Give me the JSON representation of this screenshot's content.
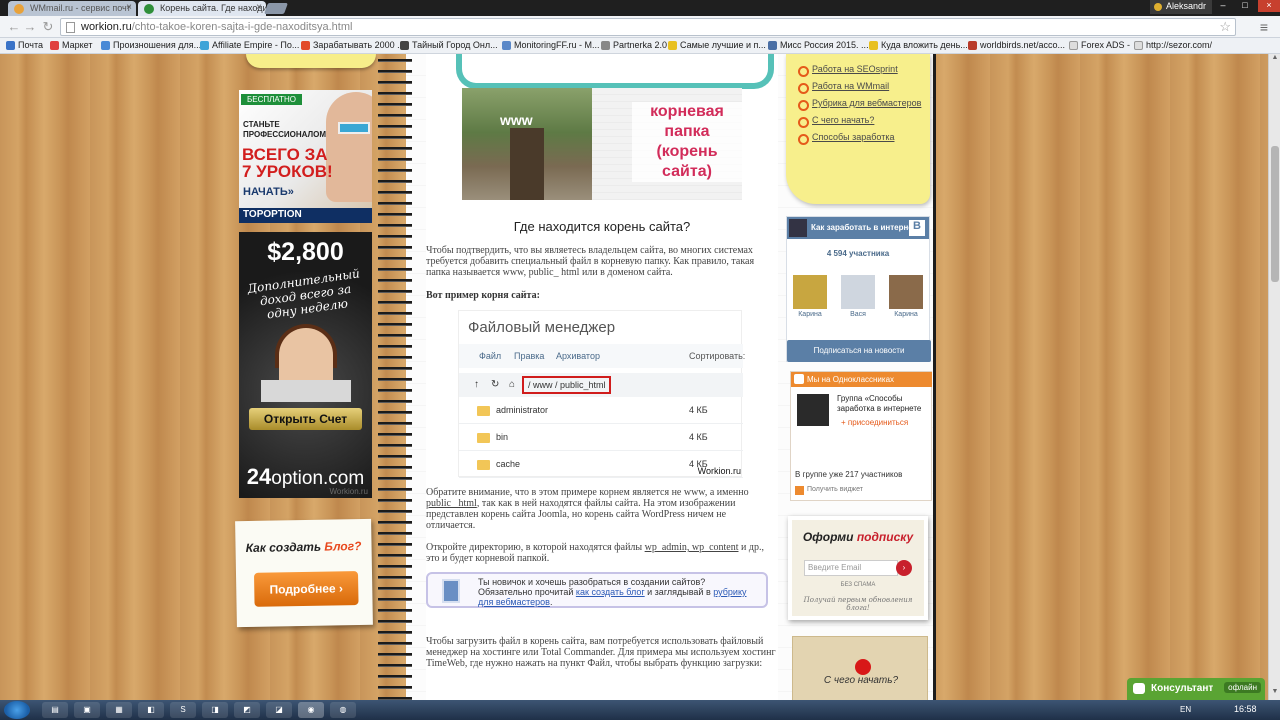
{
  "browser": {
    "tabs": [
      {
        "title": "WMmail.ru - сервис почт",
        "active": false
      },
      {
        "title": "Корень сайта. Где находи",
        "active": true
      }
    ],
    "user": "Aleksandr",
    "url_host": "workion.ru",
    "url_path": "/chto-takoe-koren-sajta-i-gde-naxoditsya.html",
    "bookmarks": [
      "Почта",
      "Маркет",
      "Произношения для...",
      "Affiliate Empire - По...",
      "Зарабатывать 2000 ...",
      "Тайный Город Онл...",
      "MonitoringFF.ru - M...",
      "Partnerka 2.0",
      "Самые лучшие и п...",
      "Мисс Россия 2015. ...",
      "Куда вложить день...",
      "worldbirds.net/acco...",
      "Forex ADS -",
      "http://sezor.com/"
    ]
  },
  "left_ads": {
    "ad1": {
      "badge": "БЕСПЛАТНО",
      "line1": "СТАНЬТЕ ПРОФЕССИОНАЛОМ",
      "line2": "ВСЕГО ЗА 7 УРОКОВ!",
      "cta": "НАЧАТЬ»",
      "brand": "TOPOPTION"
    },
    "ad2": {
      "amount": "$2,800",
      "handwriting": "Дополнительный доход всего за одну неделю",
      "button": "Открыть Счет",
      "brand_num": "24",
      "brand_name": "option.com",
      "watermark": "Workion.ru"
    },
    "blog_card": {
      "title_start": "Как создать ",
      "title_accent": "Блог?",
      "button": "Подробнее ›"
    }
  },
  "article": {
    "image_label_www": "www",
    "image_label_root": "корневая папка (корень сайта)",
    "heading": "Где находится корень сайта?",
    "p1": "Чтобы подтвердить, что вы являетесь владельцем сайта, во многих системах требуется добавить специальный файл в корневую папку. Как правило, такая папка называется www, public_ html или в доменом сайта.",
    "example_label": "Вот пример корня сайта:",
    "file_manager": {
      "title": "Файловый менеджер",
      "menu": [
        "Файл",
        "Правка",
        "Архиватор"
      ],
      "sort_label": "Сортировать:",
      "path": "/ www / public_html",
      "rows": [
        {
          "name": "administrator",
          "size": "4 КБ"
        },
        {
          "name": "bin",
          "size": "4 КБ"
        },
        {
          "name": "cache",
          "size": "4 КБ"
        }
      ],
      "watermark": "Workion.ru"
    },
    "p2_start": "Обратите внимание, что в этом примере корнем является не www, а именно ",
    "p2_link": "public_ html",
    "p2_end": ", так как в ней находятся файлы сайта. На этом изображении представлен корень сайта Joomla, но корень сайта WordPress ничем не отличается.",
    "p3_start": "Откройте директорию, в которой находятся файлы ",
    "p3_link": "wp_admin, wp_content",
    "p3_end": " и др., это и будет корневой папкой.",
    "tip": {
      "text_start": "Ты новичок и хочешь разобраться в создании сайтов? Обязательно прочитай ",
      "link1": "как создать блог",
      "text_mid": " и заглядывай в ",
      "link2": "рубрику для вебмастеров",
      "text_end": "."
    },
    "p4": "Чтобы загрузить файл в корень сайта, вам потребуется использовать файловый менеджер на хостинге или Total Commander. Для примера мы используем хостинг TimeWeb, где нужно нажать на пункт Файл, чтобы выбрать функцию загрузки:"
  },
  "right_sidebar": {
    "links": [
      "Работа на SEOsprint",
      "Работа на WMmail",
      "Рубрика для вебмастеров",
      "С чего начать?",
      "Способы заработка"
    ],
    "vk": {
      "title": "Как заработать в интерне...",
      "members": "4 594 участника",
      "people": [
        "Карина",
        "Вася",
        "Карина"
      ],
      "subscribe": "Подписаться на новости"
    },
    "ok": {
      "header": "Мы на Одноклассниках",
      "group": "Группа «Способы заработка в интернете",
      "join": "присоединиться",
      "members": "В группе уже 217 участников",
      "widget": "Получить виджет"
    },
    "subscribe": {
      "title_start": "Оформи ",
      "title_accent": "подписку",
      "placeholder": "Введите Email",
      "nospam": "БЕЗ СПАМА",
      "note": "Получай первым обновления блога!"
    },
    "begin": "С чего начать?"
  },
  "consultant": {
    "label": "Консультант",
    "status": "офлайн"
  },
  "taskbar": {
    "lang": "EN",
    "time": "16:58"
  }
}
